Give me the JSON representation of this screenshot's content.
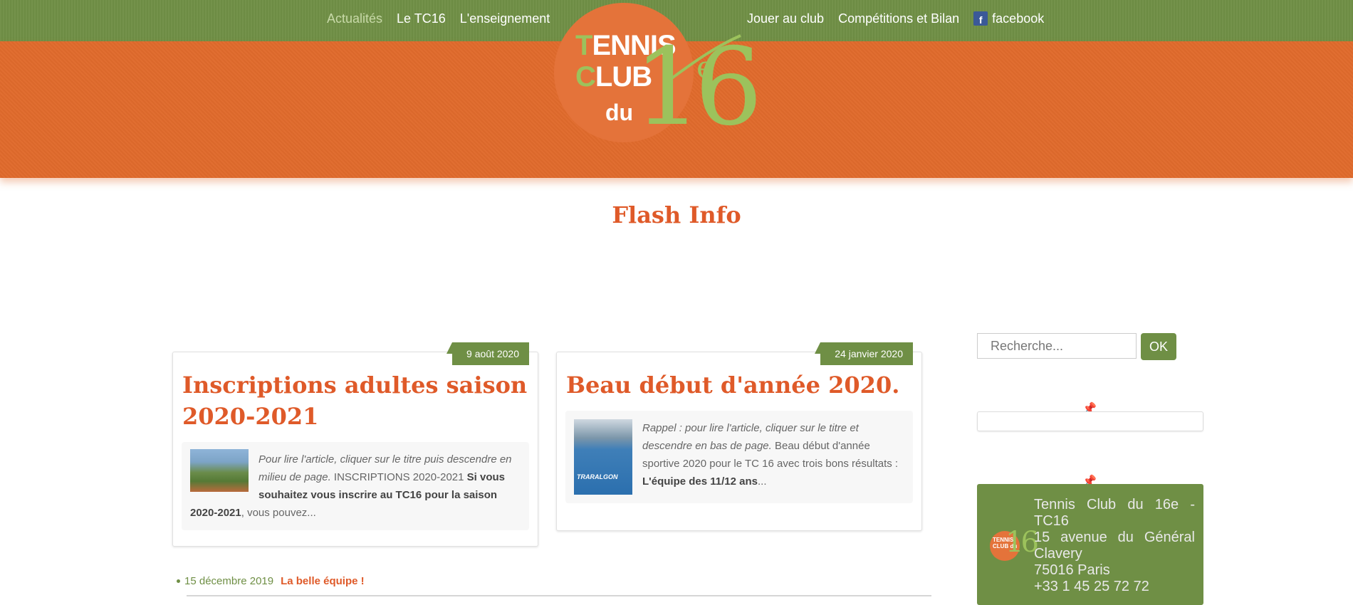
{
  "nav": {
    "left": [
      {
        "label": "Actualités",
        "active": true
      },
      {
        "label": "Le TC16"
      },
      {
        "label": "L'enseignement"
      }
    ],
    "right": [
      {
        "label": "Jouer au club"
      },
      {
        "label": "Compétitions et Bilan"
      },
      {
        "label": "facebook",
        "icon": "facebook-icon"
      }
    ]
  },
  "logo": {
    "line1_first": "T",
    "line1_rest": "ENNIS",
    "line2_first": "C",
    "line2_rest": "LUB",
    "line3": "du",
    "number": "16",
    "suffix": "e"
  },
  "page_title": "Flash Info",
  "posts": [
    {
      "date": "9 août 2020",
      "title_line1": "Inscriptions adultes saison",
      "title_line2": "2020-2021",
      "excerpt_italic": "Pour lire l'article, cliquer sur le titre puis descendre en milieu de page.",
      "excerpt_plain": " INSCRIPTIONS 2020-2021 ",
      "excerpt_bold": "Si vous souhaitez vous inscrire au TC16 pour la saison 2020-2021",
      "excerpt_end": ", vous pouvez..."
    },
    {
      "date": "24 janvier 2020",
      "title": "Beau début d'année 2020.",
      "excerpt_italic": "Rappel : pour lire l'article, cliquer sur le titre et descendre en bas de page.",
      "excerpt_plain": " Beau début d'année sportive 2020 pour le TC 16 avec trois bons résultats : ",
      "excerpt_bold": "L'équipe des 11/12 ans",
      "excerpt_end": "...",
      "thumb_label": "TRARALGON"
    }
  ],
  "older": {
    "date": "15 décembre 2019",
    "title": "La belle équipe !"
  },
  "sidebar": {
    "search_placeholder": "Recherche...",
    "search_button": "OK",
    "pin_icon": "📌",
    "contact": {
      "lines": [
        "Tennis Club du 16e - TC16",
        "15 avenue du Général Clavery",
        "75016 Paris",
        "+33 1 45 25 72 72"
      ],
      "logo_text": "TENNIS CLUB du",
      "logo_number": "16"
    }
  },
  "colors": {
    "green": "#6f8f45",
    "orange": "#e06a2c",
    "title_orange": "#df5a29",
    "light_green": "#9cc25c"
  }
}
